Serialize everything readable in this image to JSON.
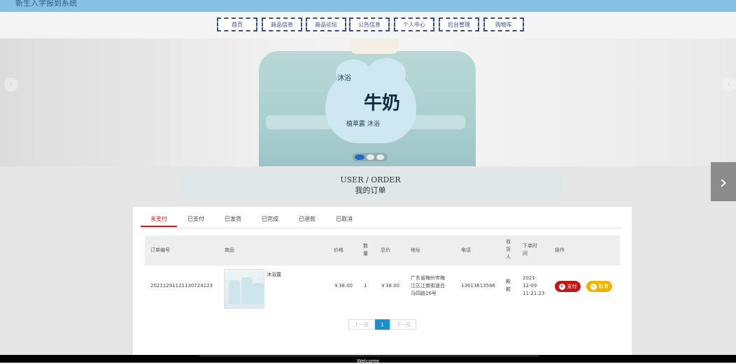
{
  "app": {
    "title": "新生入学报到系统"
  },
  "nav": [
    "首页",
    "商品信息",
    "商品论坛",
    "公告信息",
    "个人中心",
    "后台管理",
    "购物车"
  ],
  "banner": {
    "product_label_small": "沐浴",
    "product_label_big": "牛奶",
    "product_label_sub": "植萃露 沐浴",
    "prev_glyph": "‹",
    "next_glyph": "›",
    "slide_count": 3,
    "active_slide": 1
  },
  "side_next": {
    "glyph": "›"
  },
  "page_header": {
    "en": "USER / ORDER",
    "cn": "我的订单"
  },
  "tabs": [
    "未支付",
    "已支付",
    "已发货",
    "已完成",
    "已退款",
    "已取消"
  ],
  "active_tab": 0,
  "table": {
    "headers": {
      "order_no": "订单编号",
      "goods": "商品",
      "price": "价格",
      "qty": [
        "数",
        "量"
      ],
      "total": "总价",
      "address": "地址",
      "phone": "电话",
      "receiver": [
        "收",
        "货",
        "人"
      ],
      "time": [
        "下单时",
        "间"
      ],
      "ops": "操作"
    },
    "rows": [
      {
        "order_no": "20211291121130724123",
        "goods_name": "沐浴露",
        "price": "￥38.00",
        "qty": "1",
        "total": "￥38.00",
        "address": [
          "广东省梅州市梅",
          "江区江南街道白",
          "马四路16号"
        ],
        "phone": "13613613566",
        "receiver": [
          "款",
          "款"
        ],
        "time": [
          "2021-",
          "12-09",
          "11:21:23"
        ],
        "pay_label": "支付",
        "cancel_label": "取消"
      }
    ]
  },
  "pager": {
    "prev": "上一页",
    "current": "1",
    "next": "下一页"
  },
  "footer": {
    "text": "Welcome"
  },
  "colors": {
    "topbar": "#86c1e3",
    "accent_red": "#c21717",
    "accent_yellow": "#f0b400",
    "pager_active": "#1a8fd0"
  }
}
